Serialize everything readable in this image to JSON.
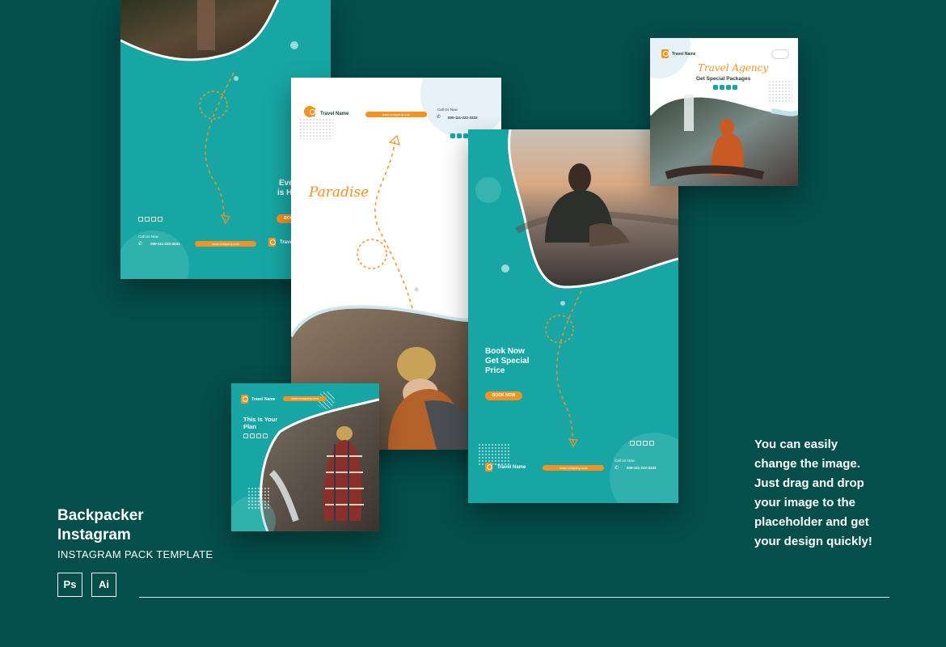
{
  "title_line1": "Backpacker",
  "title_line2": "Instagram",
  "subtitle": "INSTAGRAM PACK TEMPLATE",
  "badges": [
    "Ps",
    "Ai"
  ],
  "description": [
    "You can easily",
    "change the image.",
    "Just drag and drop",
    "your image to the",
    "placeholder and get",
    "your design quickly!"
  ],
  "colors": {
    "background": "#044e4b",
    "teal": "#17a6a3",
    "orange": "#f29322"
  },
  "card1": {
    "heading_line1": "Eve",
    "heading_line2": "is H",
    "button": "BOO",
    "call_label": "Call Us Now",
    "phone": "000-111-222-3333",
    "website": "www.company.com",
    "brand": "Travel"
  },
  "card2": {
    "brand": "Travel Name",
    "website": "www.company.com",
    "call_label": "Call Us Now",
    "phone": "000-111-222-3333",
    "script": "Paradise"
  },
  "card3": {
    "heading_line1": "Book Now",
    "heading_line2": "Get Special",
    "heading_line3": "Price",
    "button": "BOOK NOW",
    "brand": "Travel Name",
    "website": "www.company.com",
    "call_label": "Call Us Now",
    "phone": "000-111-222-3333"
  },
  "card4": {
    "brand": "Travel Name",
    "script": "Travel Agency",
    "tagline": "Get Special Packages"
  },
  "card5": {
    "brand": "Travel Name",
    "website": "www.company.com",
    "heading_line1": "This Is Your",
    "heading_line2": "Plan"
  }
}
